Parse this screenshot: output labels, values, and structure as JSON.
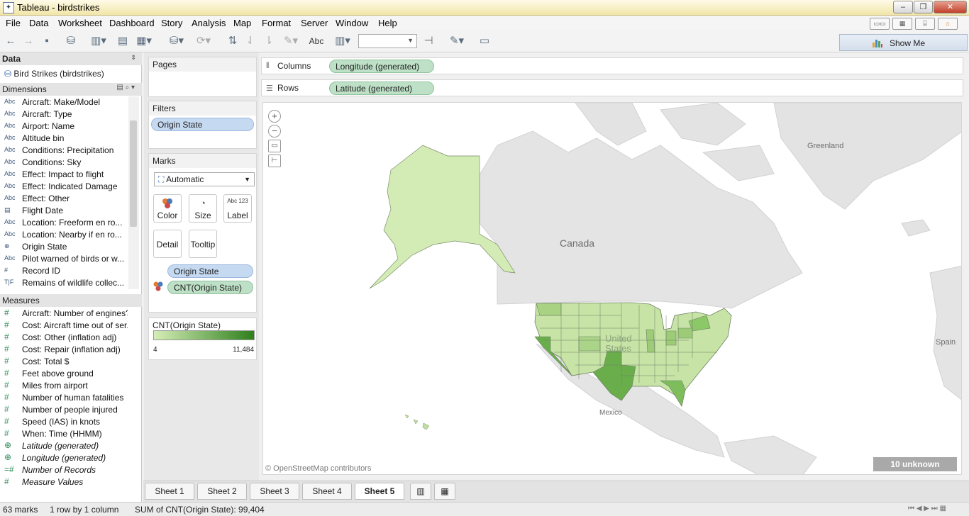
{
  "window": {
    "title": "Tableau - birdstrikes"
  },
  "menu": [
    "File",
    "Data",
    "Worksheet",
    "Dashboard",
    "Story",
    "Analysis",
    "Map",
    "Format",
    "Server",
    "Window",
    "Help"
  ],
  "toolbar": {
    "text_label": "Abc"
  },
  "show_me": {
    "label": "Show Me"
  },
  "data_pane": {
    "header": "Data",
    "datasource": "Bird Strikes (birdstrikes)",
    "dimensions_header": "Dimensions",
    "dimensions": [
      {
        "type": "Abc",
        "name": "Aircraft: Make/Model"
      },
      {
        "type": "Abc",
        "name": "Aircraft: Type"
      },
      {
        "type": "Abc",
        "name": "Airport: Name"
      },
      {
        "type": "Abc",
        "name": "Altitude bin"
      },
      {
        "type": "Abc",
        "name": "Conditions: Precipitation"
      },
      {
        "type": "Abc",
        "name": "Conditions: Sky"
      },
      {
        "type": "Abc",
        "name": "Effect: Impact to flight"
      },
      {
        "type": "Abc",
        "name": "Effect: Indicated Damage"
      },
      {
        "type": "Abc",
        "name": "Effect: Other"
      },
      {
        "type": "▤",
        "name": "Flight Date"
      },
      {
        "type": "Abc",
        "name": "Location: Freeform en ro..."
      },
      {
        "type": "Abc",
        "name": "Location: Nearby if en ro..."
      },
      {
        "type": "⊕",
        "name": "Origin State"
      },
      {
        "type": "Abc",
        "name": "Pilot warned of birds or w..."
      },
      {
        "type": "#",
        "name": "Record ID"
      },
      {
        "type": "T|F",
        "name": "Remains of wildlife collec..."
      }
    ],
    "measures_header": "Measures",
    "measures": [
      {
        "type": "#",
        "name": "Aircraft: Number of engines?",
        "italic": false
      },
      {
        "type": "#",
        "name": "Cost: Aircraft time out of ser...",
        "italic": false
      },
      {
        "type": "#",
        "name": "Cost: Other (inflation adj)",
        "italic": false
      },
      {
        "type": "#",
        "name": "Cost: Repair (inflation adj)",
        "italic": false
      },
      {
        "type": "#",
        "name": "Cost: Total $",
        "italic": false
      },
      {
        "type": "#",
        "name": "Feet above ground",
        "italic": false
      },
      {
        "type": "#",
        "name": "Miles from airport",
        "italic": false
      },
      {
        "type": "#",
        "name": "Number of human fatalities",
        "italic": false
      },
      {
        "type": "#",
        "name": "Number of people injured",
        "italic": false
      },
      {
        "type": "#",
        "name": "Speed (IAS) in knots",
        "italic": false
      },
      {
        "type": "#",
        "name": "When: Time (HHMM)",
        "italic": false
      },
      {
        "type": "⊕",
        "name": "Latitude (generated)",
        "italic": true
      },
      {
        "type": "⊕",
        "name": "Longitude (generated)",
        "italic": true
      },
      {
        "type": "=#",
        "name": "Number of Records",
        "italic": true
      },
      {
        "type": "#",
        "name": "Measure Values",
        "italic": true
      }
    ]
  },
  "pages": {
    "header": "Pages"
  },
  "filters": {
    "header": "Filters",
    "pill": "Origin State"
  },
  "marks": {
    "header": "Marks",
    "type": "Automatic",
    "buttons": {
      "color": "Color",
      "size": "Size",
      "label": "Label",
      "label_icon": "Abc 123",
      "detail": "Detail",
      "tooltip": "Tooltip"
    },
    "pill_detail": "Origin State",
    "pill_color": "CNT(Origin State)"
  },
  "legend": {
    "title": "CNT(Origin State)",
    "min": "4",
    "max": "11,484",
    "color_low": "#d5eeb7",
    "color_high": "#2f7f1c"
  },
  "columns_shelf": {
    "label": "Columns",
    "pill": "Longitude (generated)"
  },
  "rows_shelf": {
    "label": "Rows",
    "pill": "Latitude (generated)"
  },
  "map": {
    "labels": {
      "greenland": "Greenland",
      "canada": "Canada",
      "united_states": "United States",
      "mexico": "Mexico",
      "spain": "Spain"
    },
    "attribution": "© OpenStreetMap contributors",
    "unknown": "10 unknown"
  },
  "sheets": [
    {
      "name": "Sheet 1",
      "active": false
    },
    {
      "name": "Sheet 2",
      "active": false
    },
    {
      "name": "Sheet 3",
      "active": false
    },
    {
      "name": "Sheet 4",
      "active": false
    },
    {
      "name": "Sheet 5",
      "active": true
    }
  ],
  "status": {
    "marks": "63 marks",
    "dims": "1 row by 1 column",
    "sum": "SUM of CNT(Origin State): 99,404"
  }
}
